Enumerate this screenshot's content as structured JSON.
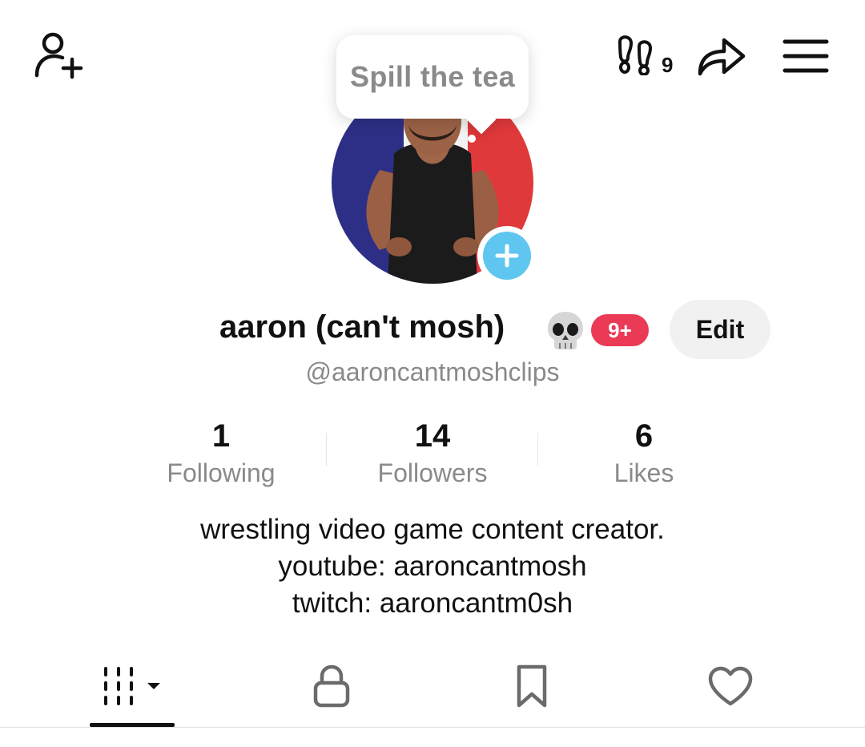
{
  "header": {
    "tooltip_text": "Spill the tea",
    "profile_visits_count": "9"
  },
  "profile": {
    "display_name": "aaron (can't mosh)",
    "name_emoji": "skull-emoji",
    "notification_badge": "9+",
    "edit_label": "Edit",
    "username": "@aaroncantmoshclips"
  },
  "stats": {
    "following": {
      "value": "1",
      "label": "Following"
    },
    "followers": {
      "value": "14",
      "label": "Followers"
    },
    "likes": {
      "value": "6",
      "label": "Likes"
    }
  },
  "bio": {
    "lines": [
      "wrestling video game content creator.",
      "youtube: aaroncantmosh",
      "twitch: aaroncantm0sh"
    ]
  },
  "tabs": [
    {
      "icon": "videos-grid-icon",
      "selected": true
    },
    {
      "icon": "lock-icon",
      "selected": false
    },
    {
      "icon": "bookmark-icon",
      "selected": false
    },
    {
      "icon": "heart-icon",
      "selected": false
    }
  ],
  "colors": {
    "badge": "#ea3a55",
    "add_photo": "#5ec6ef",
    "secondary_text": "#8a8a8a",
    "edit_button_bg": "#f1f1f2"
  }
}
